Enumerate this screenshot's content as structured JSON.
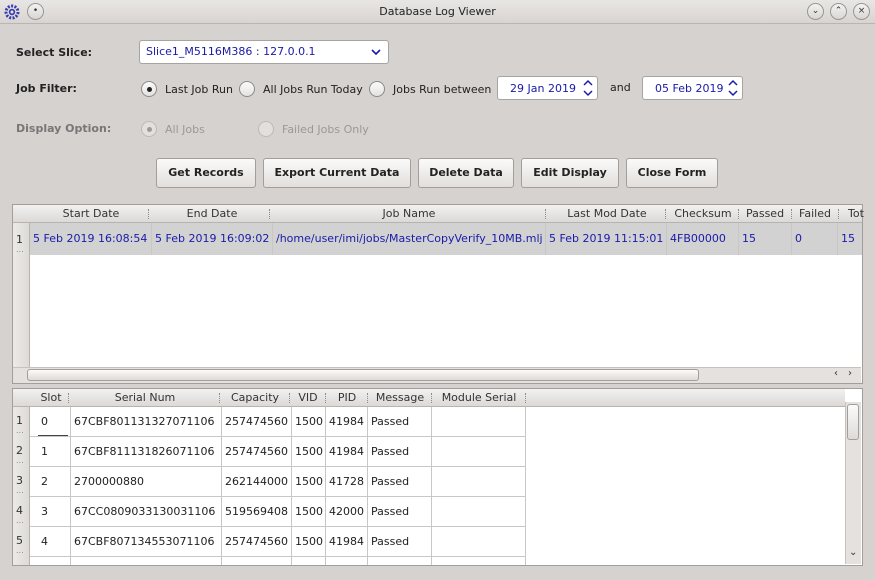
{
  "window": {
    "title": "Database Log Viewer"
  },
  "form": {
    "slice_label": "Select Slice:",
    "slice_value": "Slice1_M5116M386 : 127.0.0.1",
    "job_filter_label": "Job Filter:",
    "job_filter_options": [
      "Last Job Run",
      "All Jobs Run Today",
      "Jobs Run between"
    ],
    "job_filter_selected": "Last Job Run",
    "date_from": "29 Jan 2019",
    "and_label": "and",
    "date_to": "05 Feb 2019",
    "display_option_label": "Display Option:",
    "display_options": [
      "All Jobs",
      "Failed Jobs Only"
    ],
    "display_selected": "All Jobs"
  },
  "buttons": {
    "get_records": "Get Records",
    "export_current_data": "Export Current Data",
    "delete_data": "Delete Data",
    "edit_display": "Edit Display",
    "close_form": "Close Form"
  },
  "jobs_table": {
    "headers": [
      "Start Date",
      "End Date",
      "Job Name",
      "Last Mod Date",
      "Checksum",
      "Passed",
      "Failed",
      "Tot"
    ],
    "rows": [
      {
        "num": "1",
        "start_date": "5 Feb 2019 16:08:54",
        "end_date": "5 Feb 2019 16:09:02",
        "job_name": "/home/user/imi/jobs/MasterCopyVerify_10MB.mlj",
        "last_mod_date": "5 Feb 2019 11:15:01",
        "checksum": "4FB00000",
        "passed": "15",
        "failed": "0",
        "total": "15"
      }
    ]
  },
  "modules_table": {
    "headers": [
      "Slot",
      "Serial Num",
      "Capacity",
      "VID",
      "PID",
      "Message",
      "Module Serial"
    ],
    "rows": [
      {
        "num": "1",
        "slot": "0",
        "serial": "67CBF801131327071106",
        "capacity": "257474560",
        "vid": "1500",
        "pid": "41984",
        "message": "Passed",
        "module_serial": ""
      },
      {
        "num": "2",
        "slot": "1",
        "serial": "67CBF811131826071106",
        "capacity": "257474560",
        "vid": "1500",
        "pid": "41984",
        "message": "Passed",
        "module_serial": ""
      },
      {
        "num": "3",
        "slot": "2",
        "serial": "2700000880",
        "capacity": "262144000",
        "vid": "1500",
        "pid": "41728",
        "message": "Passed",
        "module_serial": ""
      },
      {
        "num": "4",
        "slot": "3",
        "serial": "67CC0809033130031106",
        "capacity": "519569408",
        "vid": "1500",
        "pid": "42000",
        "message": "Passed",
        "module_serial": ""
      },
      {
        "num": "5",
        "slot": "4",
        "serial": "67CBF807134553071106",
        "capacity": "257474560",
        "vid": "1500",
        "pid": "41984",
        "message": "Passed",
        "module_serial": ""
      }
    ]
  },
  "icons": {
    "app": "gear-icon",
    "menu": "window-menu-icon",
    "minimize": "chevron-down-icon",
    "maximize": "chevron-up-icon",
    "close": "close-icon"
  },
  "colors": {
    "value_text": "#1a1aa8",
    "selected_row": "#d2d2d2",
    "window_bg": "#d6d2d0"
  }
}
